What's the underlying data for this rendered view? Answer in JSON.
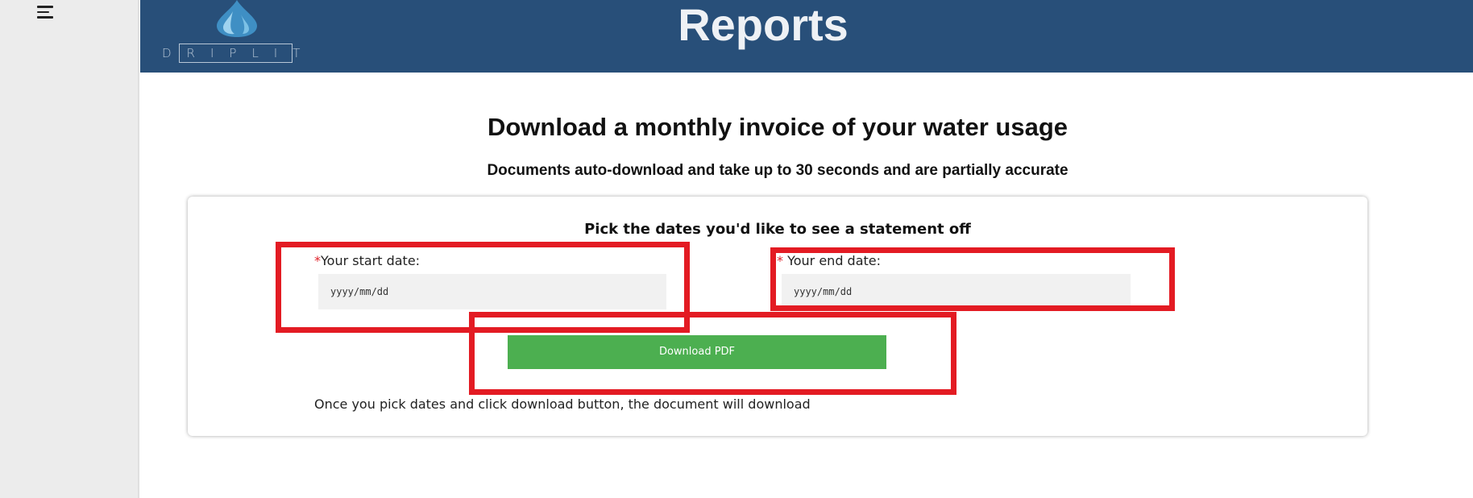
{
  "sidebar": {
    "menu_icon": "hamburger-menu-icon"
  },
  "header": {
    "logo_text": "DRIPLIT",
    "logo_icon": "water-drop-icon",
    "title": "Reports",
    "bg_color": "#284f79"
  },
  "main": {
    "headline": "Download a monthly invoice of your water usage",
    "subline": "Documents auto-download and take up to 30 seconds and are partially accurate"
  },
  "form": {
    "title": "Pick the dates you'd like to see a statement off",
    "start_required_mark": "*",
    "start_label": "Your start date:",
    "start_placeholder": "yyyy/mm/dd",
    "end_required_mark": "*",
    "end_label": " Your end date:",
    "end_placeholder": "yyyy/mm/dd",
    "download_label": "Download PDF",
    "download_color": "#4caf50",
    "hint": "Once you pick dates and click download button, the document will download"
  },
  "annotations": {
    "highlight_color": "#e31b23"
  }
}
